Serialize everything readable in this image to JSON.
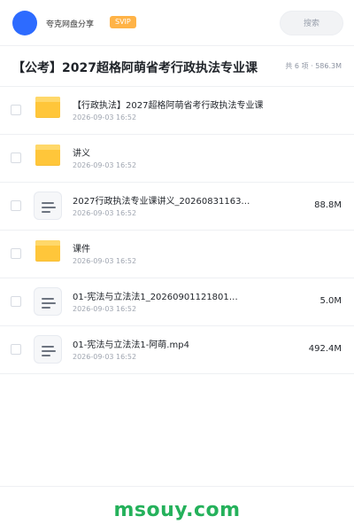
{
  "header": {
    "brand": "夸克网盘分享",
    "badge": "SVIP",
    "search_placeholder": "搜索"
  },
  "share": {
    "title": "【公考】2027超格阿萌省考行政执法专业课",
    "meta": "共 6 项 · 586.3M"
  },
  "items": [
    {
      "type": "folder",
      "name": "【行政执法】2027超格阿萌省考行政执法专业课",
      "date": "2026-09-03 16:52",
      "size": ""
    },
    {
      "type": "folder",
      "name": "讲义",
      "date": "2026-09-03 16:52",
      "size": ""
    },
    {
      "type": "file",
      "name": "2027行政执法专业课讲义_20260831163…",
      "date": "2026-09-03 16:52",
      "size": "88.8M"
    },
    {
      "type": "folder",
      "name": "课件",
      "date": "2026-09-03 16:52",
      "size": ""
    },
    {
      "type": "file",
      "name": "01-宪法与立法法1_20260901121801…",
      "date": "2026-09-03 16:52",
      "size": "5.0M"
    },
    {
      "type": "file",
      "name": "01-宪法与立法法1-阿萌.mp4",
      "date": "2026-09-03 16:52",
      "size": "492.4M"
    }
  ],
  "footer": {
    "watermark": "msouy.com"
  },
  "colors": {
    "accent": "#2d6bff",
    "svip": "#ffb347",
    "folder": "#ffc63a",
    "watermark": "#25b15b"
  }
}
